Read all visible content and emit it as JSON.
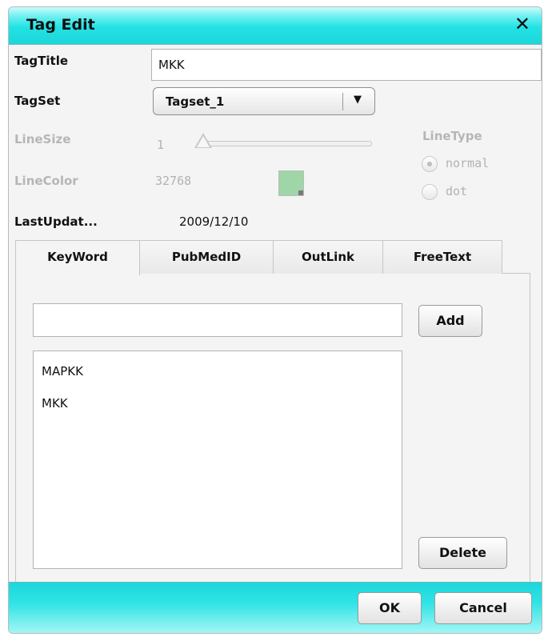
{
  "dialog": {
    "title": "Tag Edit",
    "close_glyph": "✕"
  },
  "form": {
    "tag_title_label": "TagTitle",
    "tag_title_value": "MKK",
    "tag_set_label": "TagSet",
    "tag_set_value": "Tagset_1",
    "tag_set_arrow": "▼",
    "line_size_label": "LineSize",
    "line_size_value": "1",
    "line_color_label": "LineColor",
    "line_color_value": "32768",
    "line_color_swatch": "#9ed6a8",
    "line_type_label": "LineType",
    "line_type_options": [
      "normal",
      "dot"
    ],
    "line_type_selected": "normal",
    "last_updated_label": "LastUpdat...",
    "last_updated_value": "2009/12/10"
  },
  "tabs": [
    {
      "label": "KeyWord",
      "active": true
    },
    {
      "label": "PubMedID",
      "active": false
    },
    {
      "label": "OutLink",
      "active": false
    },
    {
      "label": "FreeText",
      "active": false
    }
  ],
  "keyword_panel": {
    "input_value": "",
    "add_label": "Add",
    "items": [
      "MAPKK",
      "MKK"
    ],
    "delete_label": "Delete"
  },
  "footer": {
    "ok_label": "OK",
    "cancel_label": "Cancel"
  },
  "colors": {
    "title_bar": "#22e2e4",
    "disabled_text": "#b6b6b6"
  }
}
